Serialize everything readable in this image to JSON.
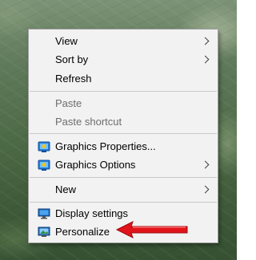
{
  "menu": {
    "view": "View",
    "sort_by": "Sort by",
    "refresh": "Refresh",
    "paste": "Paste",
    "paste_shortcut": "Paste shortcut",
    "graphics_properties": "Graphics Properties...",
    "graphics_options": "Graphics Options",
    "new": "New",
    "display_settings": "Display settings",
    "personalize": "Personalize"
  },
  "icons": {
    "graphics_properties": "intel-graphics-icon",
    "graphics_options": "intel-graphics-icon",
    "display_settings": "display-icon",
    "personalize": "personalize-icon",
    "annotation": "red-arrow-icon"
  },
  "colors": {
    "menu_bg": "#f2f2f2",
    "disabled_text": "#6d6d6d",
    "annotation_arrow": "#e0141a"
  }
}
